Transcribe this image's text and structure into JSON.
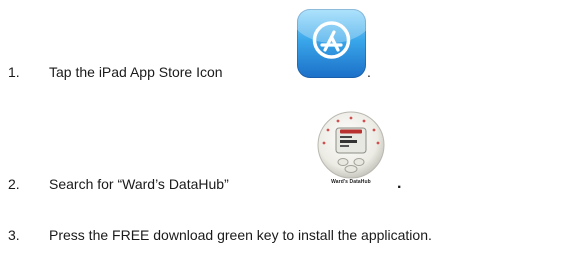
{
  "steps": [
    {
      "number": "1.",
      "text": "Tap the iPad App Store Icon",
      "trailing": "."
    },
    {
      "number": "2.",
      "text": "Search for “Ward’s DataHub”",
      "trailing": "."
    },
    {
      "number": "3.",
      "text": "Press the FREE download green key to install the application."
    }
  ],
  "icons": {
    "app_store": "app-store-icon",
    "datahub": "datahub-icon",
    "datahub_caption": "Ward's DataHub"
  },
  "colors": {
    "app_store_top": "#8fd8fb",
    "app_store_bottom": "#1b6fc8",
    "datahub_body": "#f2f2ec"
  }
}
